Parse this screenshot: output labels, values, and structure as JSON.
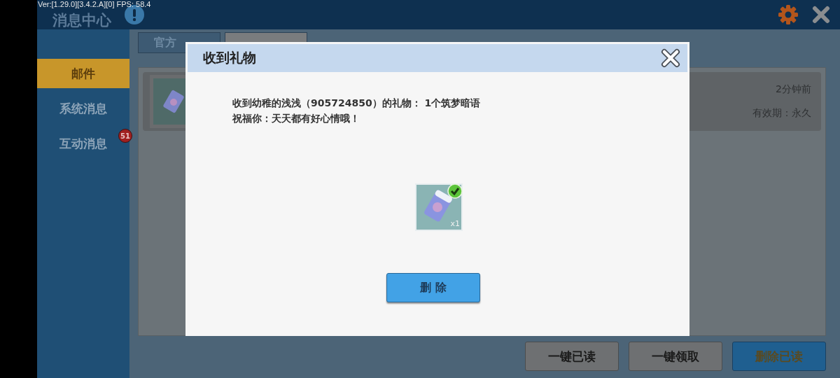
{
  "status": {
    "text": "Ver:[1.29.0][3.4.2.A][0] FPS: 58.4"
  },
  "header": {
    "title": "消息中心"
  },
  "sidebar": {
    "items": [
      {
        "label": "邮件",
        "selected": true
      },
      {
        "label": "系统消息",
        "selected": false
      },
      {
        "label": "互动消息",
        "selected": false,
        "badge": "51"
      }
    ]
  },
  "tabs": [
    {
      "label": "官方",
      "selected": false
    },
    {
      "selected": true
    }
  ],
  "mail": {
    "time": "2分钟前",
    "expiry": "有效期：永久"
  },
  "actions": [
    {
      "label": "一键已读",
      "kind": "plain"
    },
    {
      "label": "一键领取",
      "kind": "plain"
    },
    {
      "label": "删除已读",
      "kind": "primary"
    }
  ],
  "dialog": {
    "title": "收到礼物",
    "lines": [
      "收到幼稚的浅浅（905724850）的礼物： 1个筑梦暗语",
      "祝福你：天天都有好心情哦！"
    ],
    "item": {
      "count": "x1",
      "claimed": true
    },
    "button": "删 除"
  }
}
